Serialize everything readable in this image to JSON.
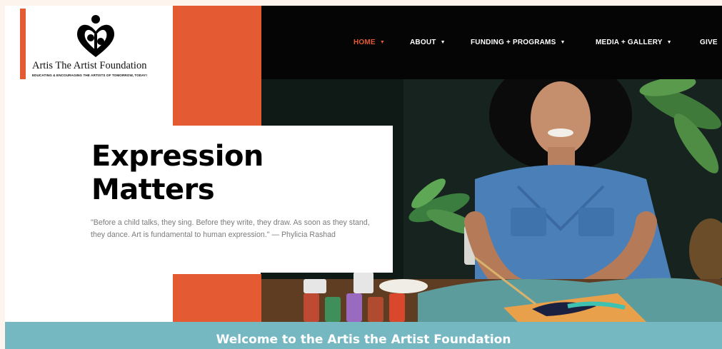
{
  "site": {
    "logo_title": "Artis The Artist Foundation",
    "logo_tagline": "EDUCATING & ENCOURAGING THE ARTISTS OF TOMORROW, TODAY!",
    "logo_icon": "heart-people-icon"
  },
  "nav": {
    "items": [
      {
        "label": "HOME",
        "active": true,
        "has_dropdown": true
      },
      {
        "label": "ABOUT",
        "active": false,
        "has_dropdown": true
      },
      {
        "label": "FUNDING + PROGRAMS",
        "active": false,
        "has_dropdown": true
      },
      {
        "label": "MEDIA + GALLERY",
        "active": false,
        "has_dropdown": true
      },
      {
        "label": "GIVE",
        "active": false,
        "has_dropdown": false
      }
    ],
    "caret_glyph": "▼"
  },
  "hero": {
    "title_line1": "Expression",
    "title_line2": "Matters",
    "quote": "\"Before a child talks, they sing.  Before they write, they draw.  As soon as they stand, they dance.  Art is fundamental to human expression.\"  —  Phylicia Rashad"
  },
  "welcome": {
    "text": "Welcome to the Artis the Artist Foundation"
  },
  "colors": {
    "accent_orange": "#e35a33",
    "nav_background": "#050505",
    "banner_teal": "#76b8c1",
    "quote_gray": "#7c7c7c"
  }
}
